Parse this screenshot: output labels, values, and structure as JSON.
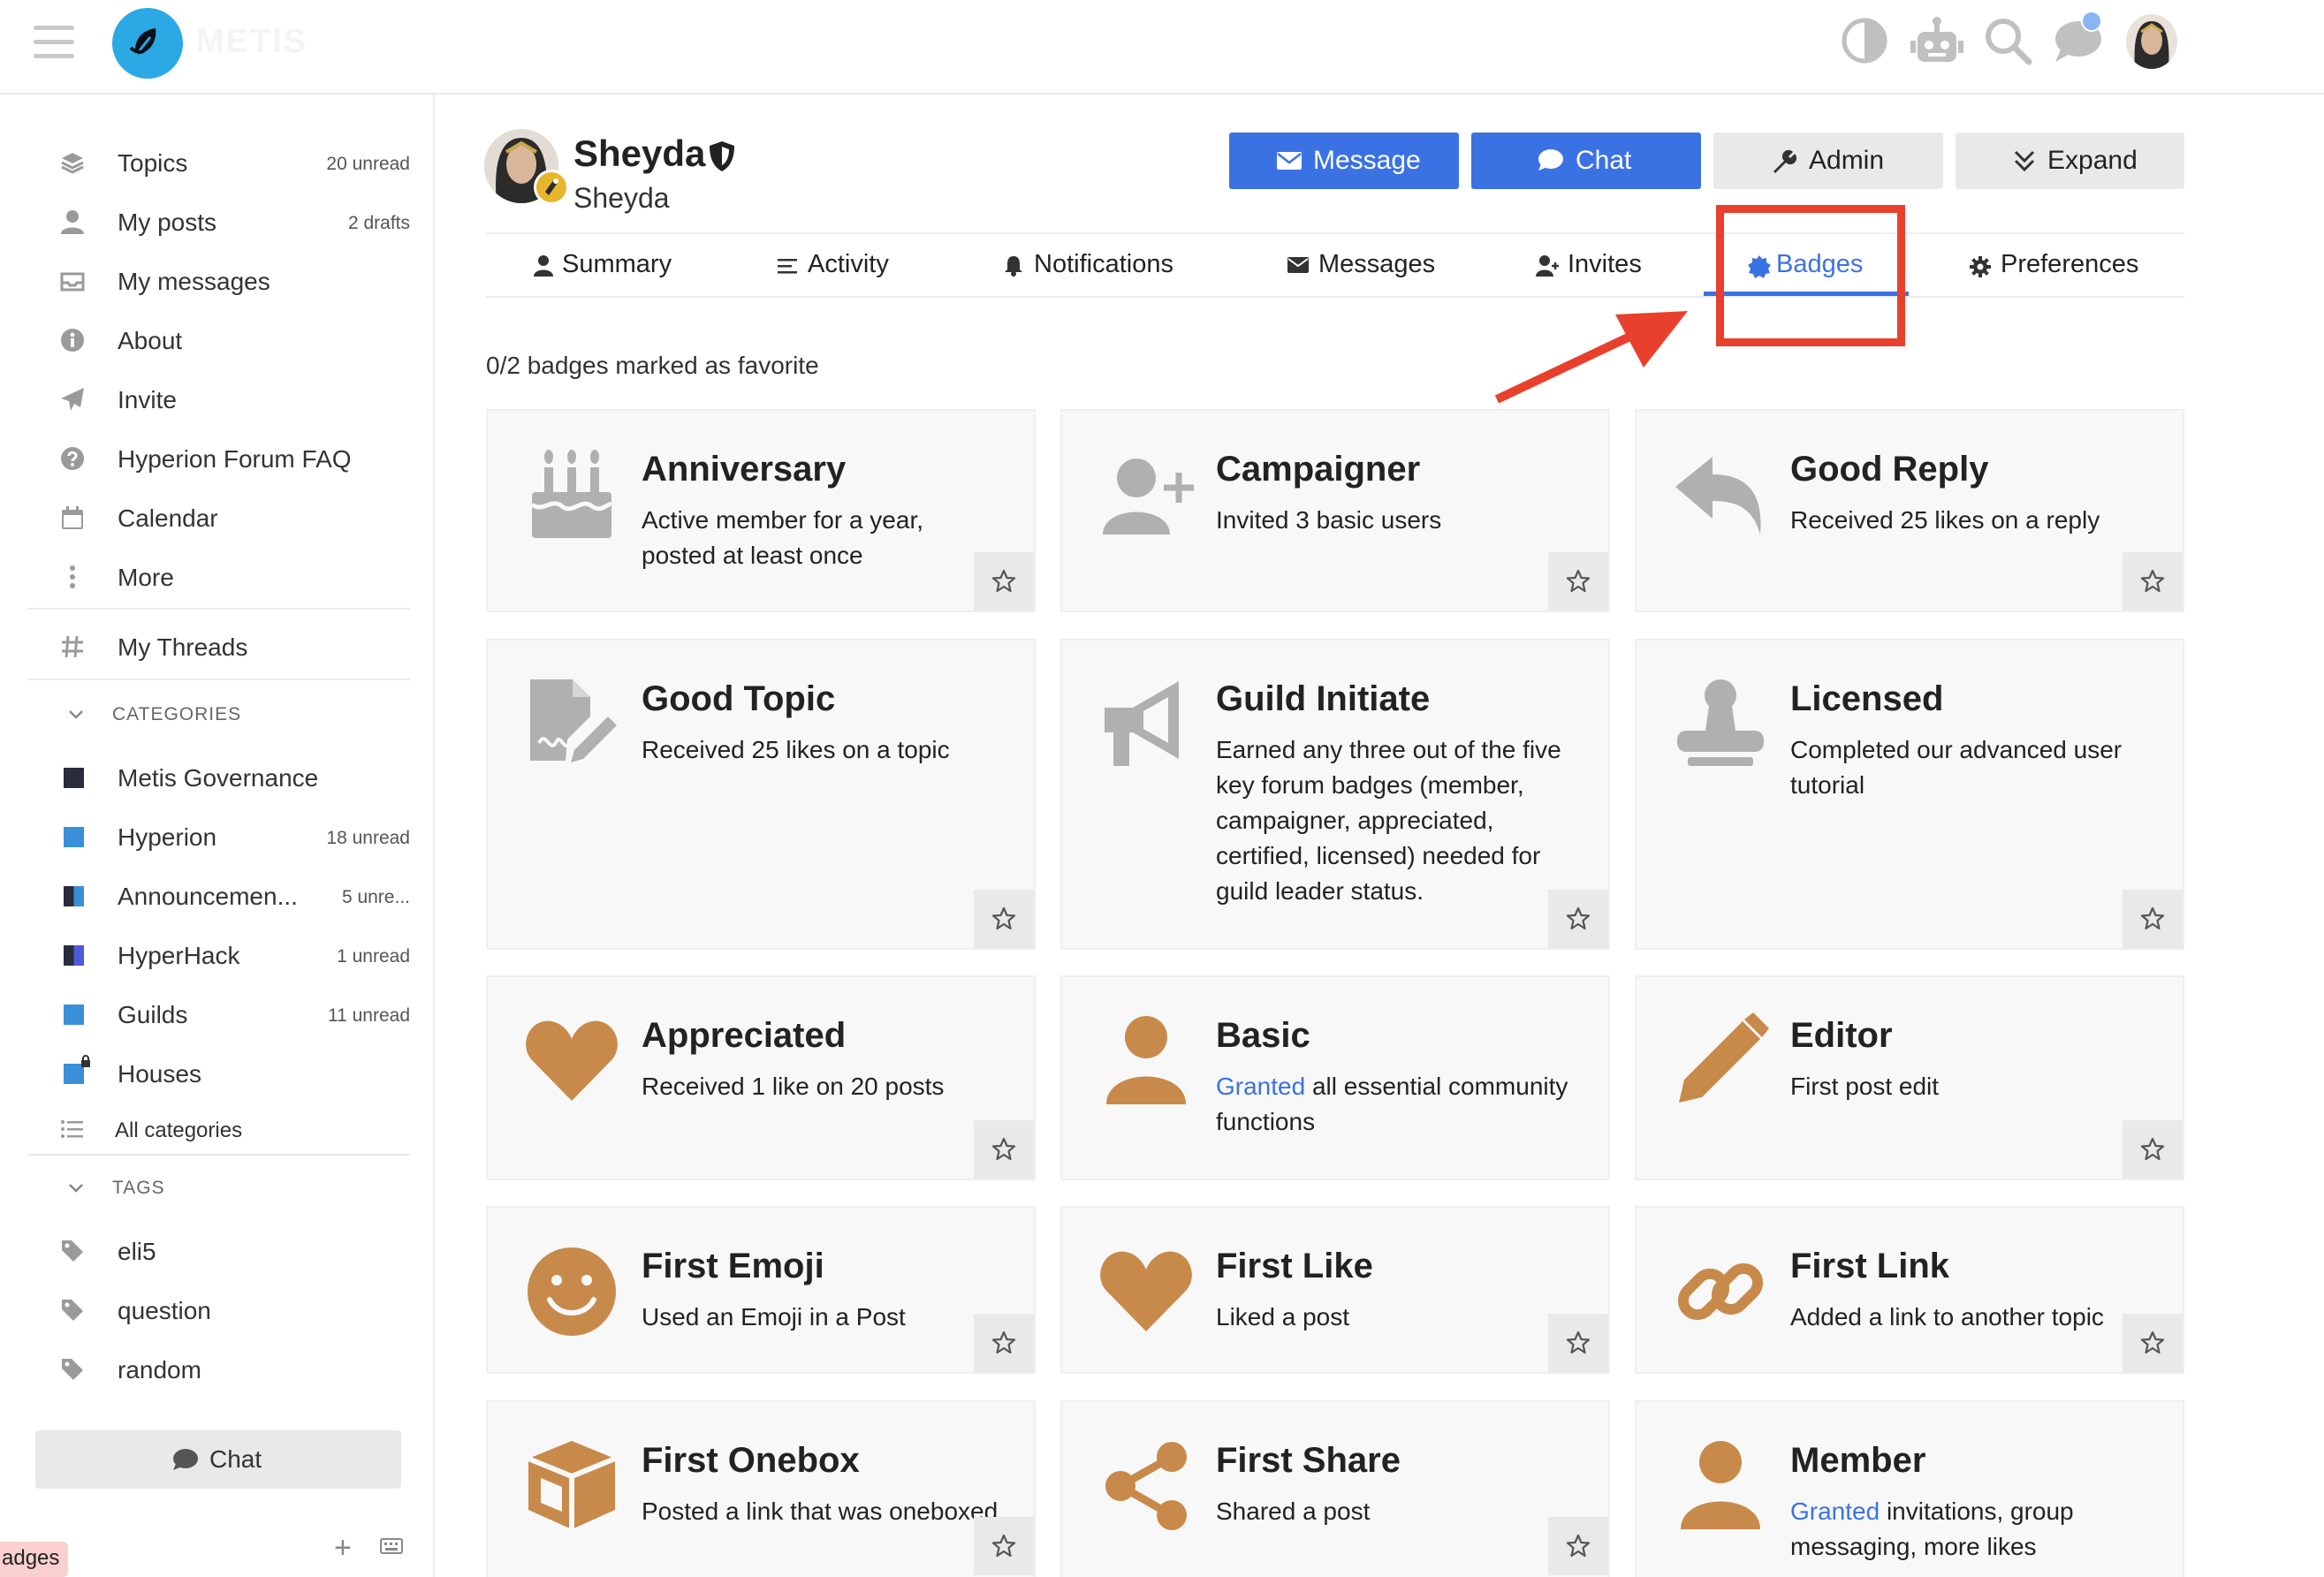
{
  "header": {
    "site_name": "METIS",
    "icons": [
      "hamburger-icon",
      "logo",
      "theme-toggle-icon",
      "robot-icon",
      "search-icon",
      "chat-bubbles-icon",
      "user-avatar"
    ]
  },
  "sidebar": {
    "items": [
      {
        "label": "Topics",
        "count": "20 unread",
        "icon": "layers-icon"
      },
      {
        "label": "My posts",
        "count": "2 drafts",
        "icon": "user-icon"
      },
      {
        "label": "My messages",
        "count": "",
        "icon": "inbox-icon"
      },
      {
        "label": "About",
        "count": "",
        "icon": "info-icon"
      },
      {
        "label": "Invite",
        "count": "",
        "icon": "paper-plane-icon"
      },
      {
        "label": "Hyperion Forum FAQ",
        "count": "",
        "icon": "question-icon"
      },
      {
        "label": "Calendar",
        "count": "",
        "icon": "calendar-icon"
      },
      {
        "label": "More",
        "count": "",
        "icon": "vertical-ellipsis-icon"
      }
    ],
    "threads_label": "My Threads",
    "categories_heading": "CATEGORIES",
    "categories": [
      {
        "label": "Metis Governance",
        "count": "",
        "color": "#2b2b3e"
      },
      {
        "label": "Hyperion",
        "count": "18 unread",
        "color": "#3b8fd9"
      },
      {
        "label": "Announcemen...",
        "count": "5 unre...",
        "color": "#3b8fd9"
      },
      {
        "label": "HyperHack",
        "count": "1 unread",
        "color": "#4d5ad9"
      },
      {
        "label": "Guilds",
        "count": "11 unread",
        "color": "#3b8fd9"
      },
      {
        "label": "Houses",
        "count": "",
        "color": "#3b8fd9"
      }
    ],
    "all_categories": "All categories",
    "tags_heading": "TAGS",
    "tags": [
      "eli5",
      "question",
      "random"
    ],
    "chat_button": "Chat",
    "tooltip": "adges"
  },
  "profile": {
    "name": "Sheyda",
    "username": "Sheyda",
    "buttons": {
      "message": "Message",
      "chat": "Chat",
      "admin": "Admin",
      "expand": "Expand"
    },
    "tabs": [
      "Summary",
      "Activity",
      "Notifications",
      "Messages",
      "Invites",
      "Badges",
      "Preferences"
    ],
    "active_tab": "Badges",
    "favorites_text": "0/2 badges marked as favorite"
  },
  "badges": [
    {
      "name": "Anniversary",
      "desc": "Active member for a year, posted at least once",
      "icon": "birthday-cake-icon",
      "granted": false
    },
    {
      "name": "Campaigner",
      "desc": "Invited 3 basic users",
      "icon": "user-plus-icon",
      "granted": false
    },
    {
      "name": "Good Reply",
      "desc": "Received 25 likes on a reply",
      "icon": "reply-icon",
      "granted": false
    },
    {
      "name": "Good Topic",
      "desc": "Received 25 likes on a topic",
      "icon": "file-signature-icon",
      "granted": false
    },
    {
      "name": "Guild Initiate",
      "desc": "Earned any three out of the five key forum badges (member, campaigner, appreciated, certified, licensed) needed for guild leader status.",
      "icon": "megaphone-icon",
      "granted": false
    },
    {
      "name": "Licensed",
      "desc": "Completed our advanced user tutorial",
      "icon": "stamp-icon",
      "granted": false
    },
    {
      "name": "Appreciated",
      "desc": "Received 1 like on 20 posts",
      "icon": "heart-icon",
      "granted": true
    },
    {
      "name": "Basic",
      "link": "Granted",
      "desc": " all essential community functions",
      "icon": "user-icon",
      "granted": true
    },
    {
      "name": "Editor",
      "desc": "First post edit",
      "icon": "pencil-icon",
      "granted": true
    },
    {
      "name": "First Emoji",
      "desc": "Used an Emoji in a Post",
      "icon": "smile-icon",
      "granted": true
    },
    {
      "name": "First Like",
      "desc": "Liked a post",
      "icon": "heart-icon",
      "granted": true
    },
    {
      "name": "First Link",
      "desc": "Added a link to another topic",
      "icon": "link-icon",
      "granted": true
    },
    {
      "name": "First Onebox",
      "desc": "Posted a link that was oneboxed",
      "icon": "cube-icon",
      "granted": true
    },
    {
      "name": "First Share",
      "desc": "Shared a post",
      "icon": "share-icon",
      "granted": true
    },
    {
      "name": "Member",
      "link": "Granted",
      "desc": " invitations, group messaging, more likes",
      "icon": "user-icon",
      "granted": true
    }
  ],
  "colors": {
    "accent": "#3b72e3",
    "badge_bronze": "#c88a4a",
    "badge_grey": "#b0b0b0",
    "highlight": "#e8402c"
  }
}
